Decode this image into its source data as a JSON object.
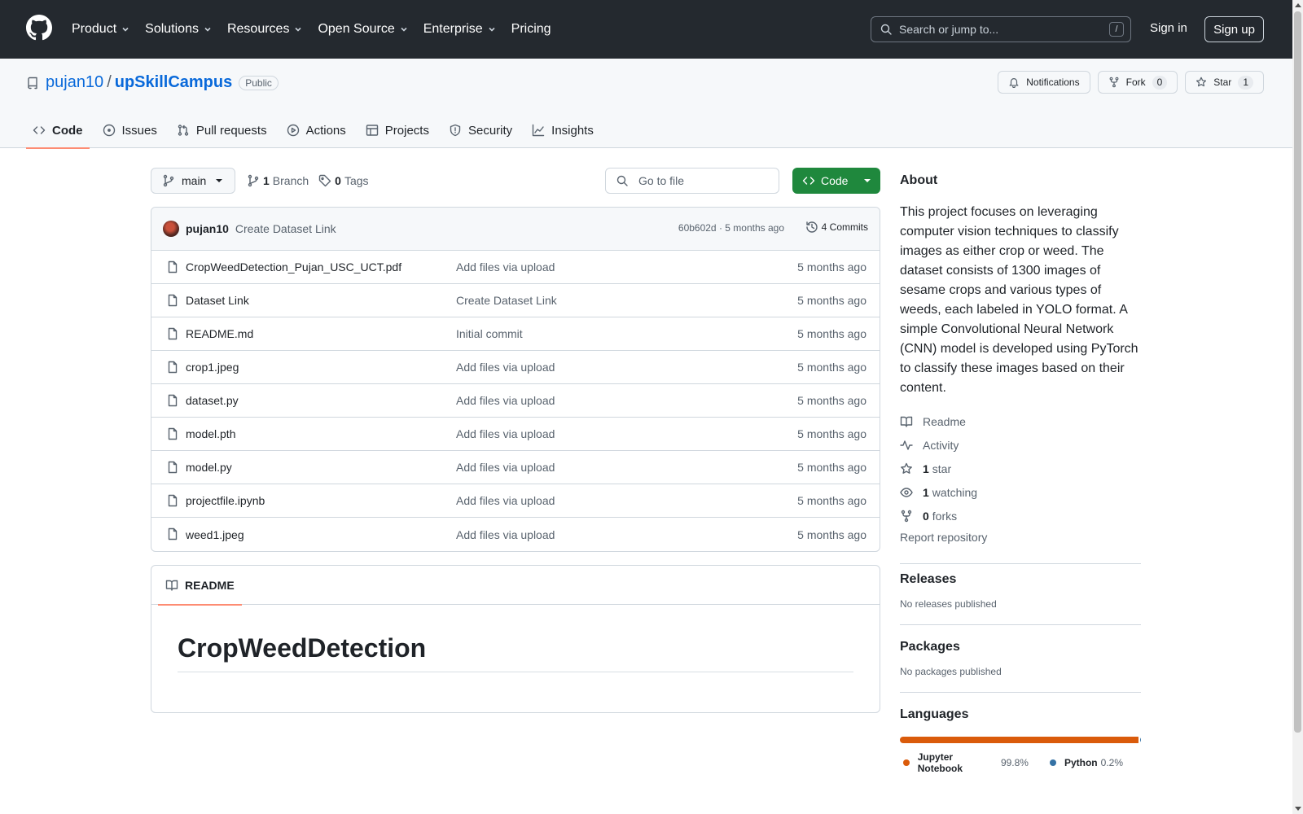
{
  "header": {
    "nav": [
      "Product",
      "Solutions",
      "Resources",
      "Open Source",
      "Enterprise",
      "Pricing"
    ],
    "search_placeholder": "Search or jump to...",
    "search_shortcut": "/",
    "signin": "Sign in",
    "signup": "Sign up"
  },
  "repo": {
    "owner": "pujan10",
    "separator": "/",
    "name": "upSkillCampus",
    "visibility": "Public",
    "notifications_label": "Notifications",
    "fork_label": "Fork",
    "fork_count": "0",
    "star_label": "Star",
    "star_count": "1"
  },
  "tabs": [
    {
      "label": "Code",
      "icon": "code-icon",
      "active": true
    },
    {
      "label": "Issues",
      "icon": "issue-icon"
    },
    {
      "label": "Pull requests",
      "icon": "pull-request-icon"
    },
    {
      "label": "Actions",
      "icon": "play-icon"
    },
    {
      "label": "Projects",
      "icon": "table-icon"
    },
    {
      "label": "Security",
      "icon": "shield-icon"
    },
    {
      "label": "Insights",
      "icon": "graph-icon"
    }
  ],
  "toolbar": {
    "branch": "main",
    "branch_count": "1",
    "branch_label": "Branch",
    "tag_count": "0",
    "tag_label": "Tags",
    "gofile_placeholder": "Go to file",
    "code_label": "Code"
  },
  "latest_commit": {
    "author": "pujan10",
    "message": "Create Dataset Link",
    "info": "60b602d · 5 months ago",
    "commits_label": "4 Commits"
  },
  "files": [
    {
      "name": "CropWeedDetection_Pujan_USC_UCT.pdf",
      "commit": "Add files via upload",
      "age": "5 months ago"
    },
    {
      "name": "Dataset Link",
      "commit": "Create Dataset Link",
      "age": "5 months ago"
    },
    {
      "name": "README.md",
      "commit": "Initial commit",
      "age": "5 months ago"
    },
    {
      "name": "crop1.jpeg",
      "commit": "Add files via upload",
      "age": "5 months ago"
    },
    {
      "name": "dataset.py",
      "commit": "Add files via upload",
      "age": "5 months ago"
    },
    {
      "name": "model.pth",
      "commit": "Add files via upload",
      "age": "5 months ago"
    },
    {
      "name": "model.py",
      "commit": "Add files via upload",
      "age": "5 months ago"
    },
    {
      "name": "projectfile.ipynb",
      "commit": "Add files via upload",
      "age": "5 months ago"
    },
    {
      "name": "weed1.jpeg",
      "commit": "Add files via upload",
      "age": "5 months ago"
    }
  ],
  "readme": {
    "tab_label": "README",
    "title": "CropWeedDetection"
  },
  "about": {
    "heading": "About",
    "description": "This project focuses on leveraging computer vision techniques to classify images as either crop or weed. The dataset consists of 1300 images of sesame crops and various types of weeds, each labeled in YOLO format. A simple Convolutional Neural Network (CNN) model is developed using PyTorch to classify these images based on their content.",
    "readme_link": "Readme",
    "activity_link": "Activity",
    "stars_count": "1",
    "stars_label": "star",
    "watching_count": "1",
    "watching_label": "watching",
    "forks_count": "0",
    "forks_label": "forks",
    "report": "Report repository"
  },
  "releases": {
    "heading": "Releases",
    "text": "No releases published"
  },
  "packages": {
    "heading": "Packages",
    "text": "No packages published"
  },
  "languages": {
    "heading": "Languages",
    "items": [
      {
        "name": "Jupyter Notebook",
        "percent": "99.8%",
        "value": 99.8,
        "color": "#DA5B0B"
      },
      {
        "name": "Python",
        "percent": "0.2%",
        "value": 0.2,
        "color": "#3572A5"
      }
    ]
  }
}
